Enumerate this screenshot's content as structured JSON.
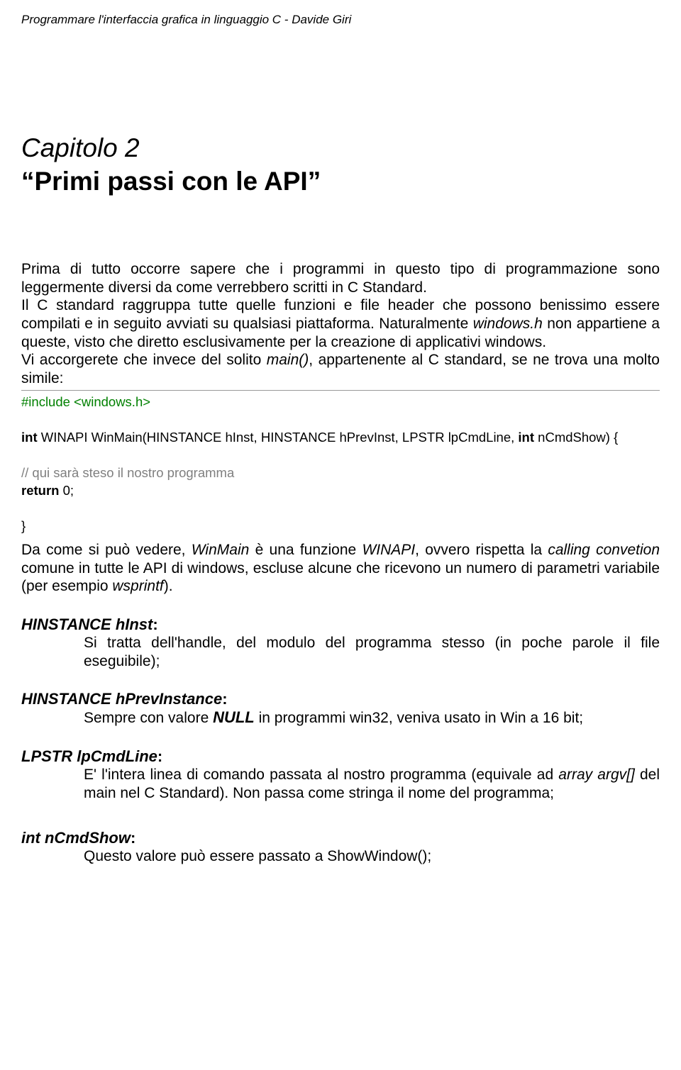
{
  "header": "Programmare l'interfaccia grafica in linguaggio C  -  Davide Giri",
  "chapter": {
    "number": "Capitolo 2",
    "title": "“Primi passi con le API”"
  },
  "p1_a": "Prima di tutto occorre sapere che i programmi in questo tipo di programmazione sono leggermente diversi da come verrebbero scritti in C Standard.",
  "p1_b": "Il C standard raggruppa tutte quelle funzioni e file header che possono benissimo essere compilati e in seguito avviati su qualsiasi piattaforma. Naturalmente ",
  "p1_c": "windows.h",
  "p1_d": " non appartiene a queste, visto che diretto esclusivamente per la creazione di applicativi windows.",
  "p1_e": "Vi accorgerete che invece del solito ",
  "p1_f": "main()",
  "p1_g": ", appartenente al C standard, se ne trova una molto simile:",
  "code": {
    "l1": "#include <windows.h>",
    "l2a": "int",
    "l2b": " WINAPI WinMain(HINSTANCE hInst, HINSTANCE hPrevInst, LPSTR lpCmdLine, ",
    "l2c": "int",
    "l2d": " nCmdShow) {",
    "l3": "// qui sarà steso il nostro programma",
    "l4a": "return",
    "l4b": " 0;",
    "l5": "}"
  },
  "p2_a": "Da come si può vedere, ",
  "p2_b": "WinMain",
  "p2_c": " è una funzione ",
  "p2_d": "WINAPI",
  "p2_e": ", ovvero rispetta la ",
  "p2_f": "calling convetion",
  "p2_g": " comune in tutte le API di windows, escluse alcune che ricevono un numero di parametri variabile (per esempio ",
  "p2_h": "wsprintf",
  "p2_i": ").",
  "params": {
    "hinst": {
      "head": "HINSTANCE hInst",
      "desc": "Si tratta dell'handle, del modulo del programma stesso (in poche parole il file eseguibile);"
    },
    "hprev": {
      "head": "HINSTANCE hPrevInstance",
      "desc_a": "Sempre con valore ",
      "desc_b": "NULL",
      "desc_c": " in programmi win32, veniva usato in Win a 16 bit;"
    },
    "lp": {
      "head": "LPSTR lpCmdLine",
      "desc_a": "E' l'intera linea di comando passata al nostro programma (equivale ad ",
      "desc_b": "array argv[]",
      "desc_c": " del main nel C Standard). Non passa come stringa il nome del programma;"
    },
    "ncmd": {
      "head": "int nCmdShow",
      "desc": "Questo valore può essere passato a ShowWindow();"
    }
  }
}
